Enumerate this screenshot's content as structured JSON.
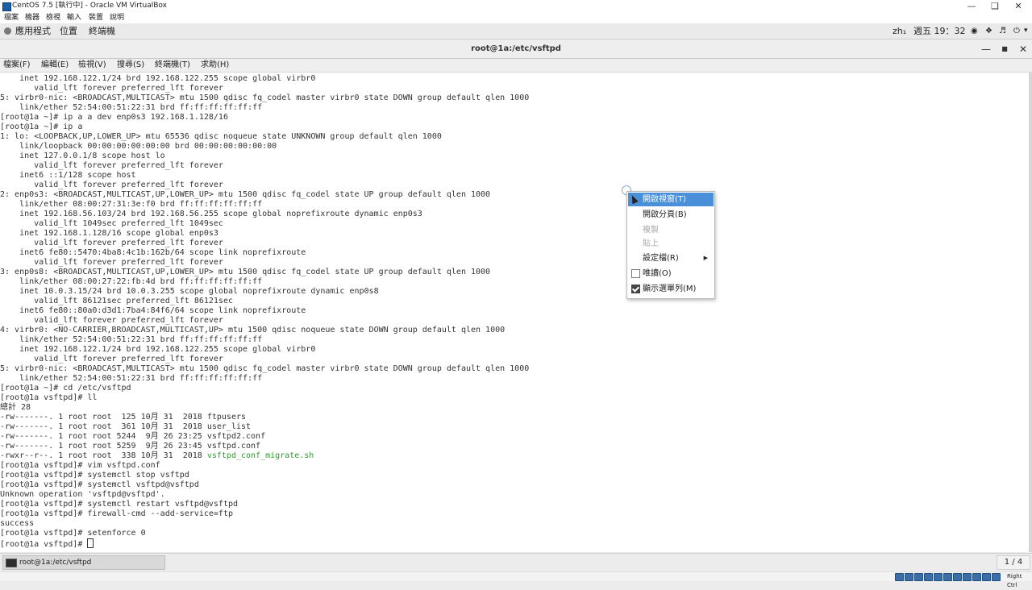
{
  "vbox": {
    "title": "CentOS 7.5 [執行中] - Oracle VM VirtualBox",
    "menu": [
      "檔案",
      "機器",
      "檢視",
      "輸入",
      "裝置",
      "說明"
    ],
    "window_controls": [
      "minimize-icon",
      "restore-icon",
      "close-icon"
    ],
    "host_key": "Right Ctrl",
    "status_icons": [
      "hard-disk-icon",
      "optical-drive-icon",
      "audio-icon",
      "network-icon",
      "usb-icon",
      "shared-folder-icon",
      "display-icon",
      "video-capture-icon",
      "cpu-icon",
      "mouse-integration-icon",
      "keyboard-icon"
    ]
  },
  "gnome": {
    "applications": "應用程式",
    "places": "位置",
    "terminal": "終端機",
    "input_method": "zh₁",
    "clock": "週五 19：32"
  },
  "terminal_window": {
    "title": "root@1a:/etc/vsftpd",
    "menu": [
      "檔案(F)",
      "編輯(E)",
      "檢視(V)",
      "搜尋(S)",
      "終端機(T)",
      "求助(H)"
    ]
  },
  "terminal": {
    "lines": [
      "    inet 192.168.122.1/24 brd 192.168.122.255 scope global virbr0",
      "       valid_lft forever preferred_lft forever",
      "5: virbr0-nic: <BROADCAST,MULTICAST> mtu 1500 qdisc fq_codel master virbr0 state DOWN group default qlen 1000",
      "    link/ether 52:54:00:51:22:31 brd ff:ff:ff:ff:ff:ff",
      "[root@1a ~]# ip a a dev enp0s3 192.168.1.128/16",
      "[root@1a ~]# ip a",
      "1: lo: <LOOPBACK,UP,LOWER_UP> mtu 65536 qdisc noqueue state UNKNOWN group default qlen 1000",
      "    link/loopback 00:00:00:00:00:00 brd 00:00:00:00:00:00",
      "    inet 127.0.0.1/8 scope host lo",
      "       valid_lft forever preferred_lft forever",
      "    inet6 ::1/128 scope host",
      "       valid_lft forever preferred_lft forever",
      "2: enp0s3: <BROADCAST,MULTICAST,UP,LOWER_UP> mtu 1500 qdisc fq_codel state UP group default qlen 1000",
      "    link/ether 08:00:27:31:3e:f0 brd ff:ff:ff:ff:ff:ff",
      "    inet 192.168.56.103/24 brd 192.168.56.255 scope global noprefixroute dynamic enp0s3",
      "       valid_lft 1049sec preferred_lft 1049sec",
      "    inet 192.168.1.128/16 scope global enp0s3",
      "       valid_lft forever preferred_lft forever",
      "    inet6 fe80::5470:4ba8:4c1b:162b/64 scope link noprefixroute",
      "       valid_lft forever preferred_lft forever",
      "3: enp0s8: <BROADCAST,MULTICAST,UP,LOWER_UP> mtu 1500 qdisc fq_codel state UP group default qlen 1000",
      "    link/ether 08:00:27:22:fb:4d brd ff:ff:ff:ff:ff:ff",
      "    inet 10.0.3.15/24 brd 10.0.3.255 scope global noprefixroute dynamic enp0s8",
      "       valid_lft 86121sec preferred_lft 86121sec",
      "    inet6 fe80::80a0:d3d1:7ba4:84f6/64 scope link noprefixroute",
      "       valid_lft forever preferred_lft forever",
      "4: virbr0: <NO-CARRIER,BROADCAST,MULTICAST,UP> mtu 1500 qdisc noqueue state DOWN group default qlen 1000",
      "    link/ether 52:54:00:51:22:31 brd ff:ff:ff:ff:ff:ff",
      "    inet 192.168.122.1/24 brd 192.168.122.255 scope global virbr0",
      "       valid_lft forever preferred_lft forever",
      "5: virbr0-nic: <BROADCAST,MULTICAST> mtu 1500 qdisc fq_codel master virbr0 state DOWN group default qlen 1000",
      "    link/ether 52:54:00:51:22:31 brd ff:ff:ff:ff:ff:ff",
      "[root@1a ~]# cd /etc/vsftpd",
      "[root@1a vsftpd]# ll",
      "總計 28",
      "-rw-------. 1 root root  125 10月 31  2018 ftpusers",
      "-rw-------. 1 root root  361 10月 31  2018 user_list",
      "-rw-------. 1 root root 5244  9月 26 23:25 vsftpd2.conf",
      "-rw-------. 1 root root 5259  9月 26 23:45 vsftpd.conf",
      "-rwxr--r--. 1 root root  338 10月 31  2018 ",
      "[root@1a vsftpd]# vim vsftpd.conf",
      "[root@1a vsftpd]# systemctl stop vsftpd",
      "[root@1a vsftpd]# systemctl vsftpd@vsftpd",
      "Unknown operation 'vsftpd@vsftpd'.",
      "[root@1a vsftpd]# systemctl restart vsftpd@vsftpd",
      "[root@1a vsftpd]# firewall-cmd --add-service=ftp",
      "success",
      "[root@1a vsftpd]# setenforce 0",
      "[root@1a vsftpd]# "
    ],
    "highlight_file": "vsftpd_conf_migrate.sh",
    "highlight_color": "#2f9b2f"
  },
  "context_menu": {
    "open_window": "開啟視窗(T)",
    "open_tab": "開啟分頁(B)",
    "copy": "複製",
    "paste": "貼上",
    "profiles": "設定檔(R)",
    "read_only": "唯讀(O)",
    "show_menubar": "顯示選單列(M)",
    "read_only_checked": false,
    "show_menubar_checked": true
  },
  "taskbar": {
    "task_label": "root@1a:/etc/vsftpd",
    "workspace": "1 / 4"
  }
}
